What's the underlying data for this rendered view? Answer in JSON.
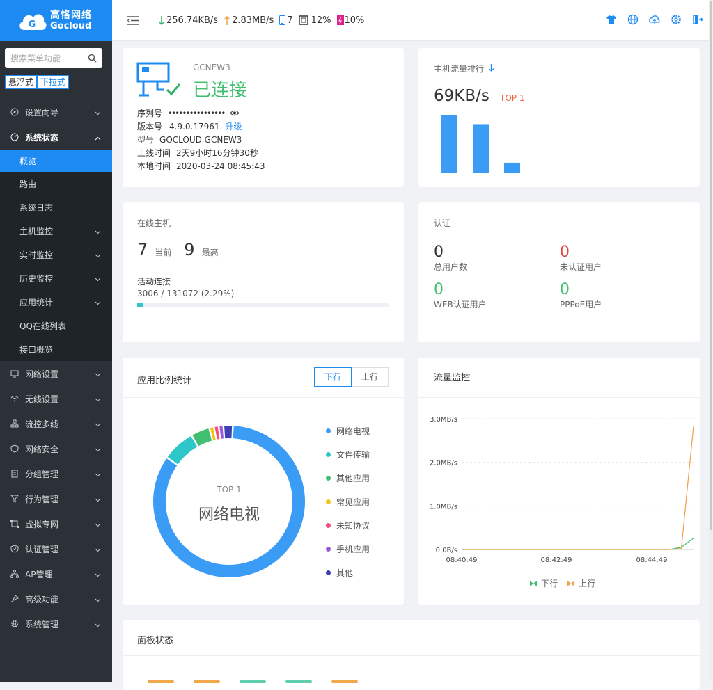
{
  "brand": {
    "cn": "高恪网络",
    "en": "Gocloud"
  },
  "search": {
    "placeholder": "搜索菜单功能"
  },
  "modes": {
    "float": "悬浮式",
    "dropdown": "下拉式"
  },
  "menu": {
    "setup_wizard": "设置向导",
    "system_status": "系统状态",
    "sub": {
      "overview": "概览",
      "route": "路由",
      "syslog": "系统日志",
      "host_monitor": "主机监控",
      "realtime_monitor": "实时监控",
      "history_monitor": "历史监控",
      "app_stats": "应用统计",
      "qq_list": "QQ在线列表",
      "iface_overview": "接口概览"
    },
    "network_settings": "网络设置",
    "wireless_settings": "无线设置",
    "flow_multiline": "流控多线",
    "network_security": "网络安全",
    "group_mgmt": "分组管理",
    "behavior_mgmt": "行为管理",
    "vpn": "虚拟专网",
    "auth_mgmt": "认证管理",
    "ap_mgmt": "AP管理",
    "advanced": "高级功能",
    "system_mgmt": "系统管理"
  },
  "topbar": {
    "download": "256.74KB/s",
    "upload": "2.83MB/s",
    "devices": "7",
    "cpu": "12%",
    "mem": "10%"
  },
  "device": {
    "name": "GCNEW3",
    "status": "已连接",
    "serial_label": "序列号",
    "serial_value": "••••••••••••••••",
    "version_label": "版本号",
    "version_value": "4.9.0.17961",
    "upgrade": "升级",
    "model_label": "型号",
    "model_value": "GOCLOUD GCNEW3",
    "uptime_label": "上线时间",
    "uptime_value": "2天9小时16分钟30秒",
    "localtime_label": "本地时间",
    "localtime_value": "2020-03-24 08:45:43"
  },
  "host_rank": {
    "title": "主机流量排行",
    "value": "69KB/s",
    "badge": "TOP 1",
    "bars": [
      100,
      84,
      18
    ]
  },
  "online_hosts": {
    "title": "在线主机",
    "current": "7",
    "current_label": "当前",
    "max": "9",
    "max_label": "最高",
    "conn_label": "活动连接",
    "conn_value": "3006 / 131072 (2.29%)",
    "conn_ratio": 0.0229
  },
  "auth": {
    "title": "认证",
    "total": "0",
    "total_label": "总用户数",
    "unauth": "0",
    "unauth_label": "未认证用户",
    "web": "0",
    "web_label": "WEB认证用户",
    "pppoe": "0",
    "pppoe_label": "PPPoE用户"
  },
  "app_ratio": {
    "title": "应用比例统计",
    "tab_down": "下行",
    "tab_up": "上行",
    "center_top": "TOP 1",
    "center_name": "网络电视",
    "legend": [
      {
        "name": "网络电视",
        "color": "#3a9cf5"
      },
      {
        "name": "文件传输",
        "color": "#2ec7c9"
      },
      {
        "name": "其他应用",
        "color": "#3fbf6f"
      },
      {
        "name": "常见应用",
        "color": "#f5c318"
      },
      {
        "name": "未知协议",
        "color": "#f0507a"
      },
      {
        "name": "手机应用",
        "color": "#9b59d8"
      },
      {
        "name": "其他",
        "color": "#3f3fb0"
      }
    ],
    "slices": [
      84,
      7,
      4,
      1,
      1,
      1,
      2
    ]
  },
  "traffic": {
    "title": "流量监控",
    "legend_down": "下行",
    "legend_up": "上行"
  },
  "panel": {
    "title": "面板状态"
  },
  "chart_data": [
    {
      "type": "pie",
      "title": "应用比例统计",
      "categories": [
        "网络电视",
        "文件传输",
        "其他应用",
        "常见应用",
        "未知协议",
        "手机应用",
        "其他"
      ],
      "values": [
        84,
        7,
        4,
        1,
        1,
        1,
        2
      ]
    },
    {
      "type": "line",
      "title": "流量监控",
      "x_ticks": [
        "08:40:49",
        "08:42:49",
        "08:44:49"
      ],
      "y_ticks": [
        "0.0B/s",
        "1.0MB/s",
        "2.0MB/s",
        "3.0MB/s"
      ],
      "ylim": [
        0,
        3
      ],
      "yunit": "MB/s",
      "series": [
        {
          "name": "下行",
          "color": "#3fbf6f",
          "values": [
            0,
            0,
            0,
            0,
            0,
            0,
            0,
            0,
            0,
            0,
            0,
            0,
            0,
            0,
            0,
            0,
            0,
            0,
            0.05,
            0.26
          ]
        },
        {
          "name": "上行",
          "color": "#f0a04b",
          "values": [
            0,
            0,
            0,
            0,
            0,
            0,
            0,
            0,
            0,
            0,
            0,
            0,
            0,
            0,
            0,
            0,
            0,
            0,
            0.02,
            2.83
          ]
        }
      ]
    },
    {
      "type": "bar",
      "title": "主机流量排行",
      "values": [
        100,
        84,
        18
      ]
    }
  ]
}
